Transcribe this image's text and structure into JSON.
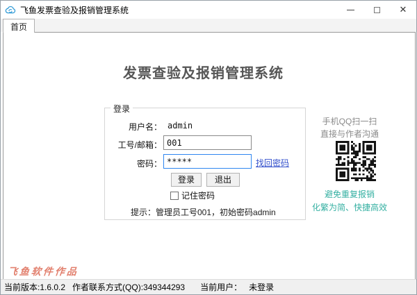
{
  "window": {
    "title": "飞鱼发票查验及报销管理系统",
    "controls": {
      "minimize": "",
      "maximize": "",
      "close": "✕"
    }
  },
  "tabs": [
    {
      "label": "首页"
    }
  ],
  "main": {
    "heading": "发票查验及报销管理系统",
    "login": {
      "group_label": "登录",
      "username_label": "用户名：",
      "username_value": "admin",
      "userid_label": "工号/邮箱：",
      "userid_value": "001",
      "password_label": "密码：",
      "password_value": "*****",
      "forgot_link": "找回密码",
      "login_button": "登录",
      "exit_button": "退出",
      "remember_label": "记住密码",
      "remember_checked": false,
      "hint": "提示：管理员工号001，初始密码admin"
    },
    "promo": {
      "qq_line1": "手机QQ扫一扫",
      "qq_line2": "直接与作者沟通",
      "slogan1": "避免重复报销",
      "slogan2": "化繁为简、快捷高效"
    },
    "watermark": "飞鱼软件作品"
  },
  "statusbar": {
    "version": "当前版本:1.6.0.2",
    "contact": "作者联系方式(QQ):349344293",
    "user_label": "当前用户：",
    "user_value": "未登录"
  },
  "colors": {
    "focused_input_border": "#2e86f0",
    "link_blue": "#3350cc",
    "slogan_teal": "#35b0a2",
    "watermark_red": "#e2806e",
    "icon_blue": "#2f9ad6",
    "heading_gray": "#565656"
  }
}
